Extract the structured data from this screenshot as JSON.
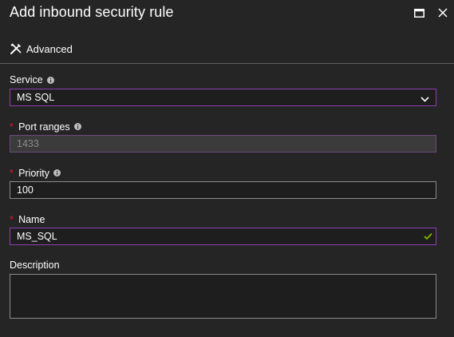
{
  "header": {
    "title": "Add inbound security rule",
    "icons": [
      "maximize-icon",
      "close-icon"
    ]
  },
  "toolbar": {
    "advanced_label": "Advanced",
    "advanced_icon": "tools-icon"
  },
  "form": {
    "service": {
      "label": "Service",
      "required": false,
      "value": "MS SQL"
    },
    "port_ranges": {
      "label": "Port ranges",
      "required": true,
      "value": "1433",
      "disabled": true
    },
    "priority": {
      "label": "Priority",
      "required": true,
      "value": "100"
    },
    "name": {
      "label": "Name",
      "required": true,
      "value": "MS_SQL",
      "valid": true
    },
    "description": {
      "label": "Description",
      "value": ""
    }
  },
  "colors": {
    "background": "#252526",
    "focus_border": "#8f3fb0",
    "required_star": "#e81123",
    "valid_check": "#7fba00"
  }
}
